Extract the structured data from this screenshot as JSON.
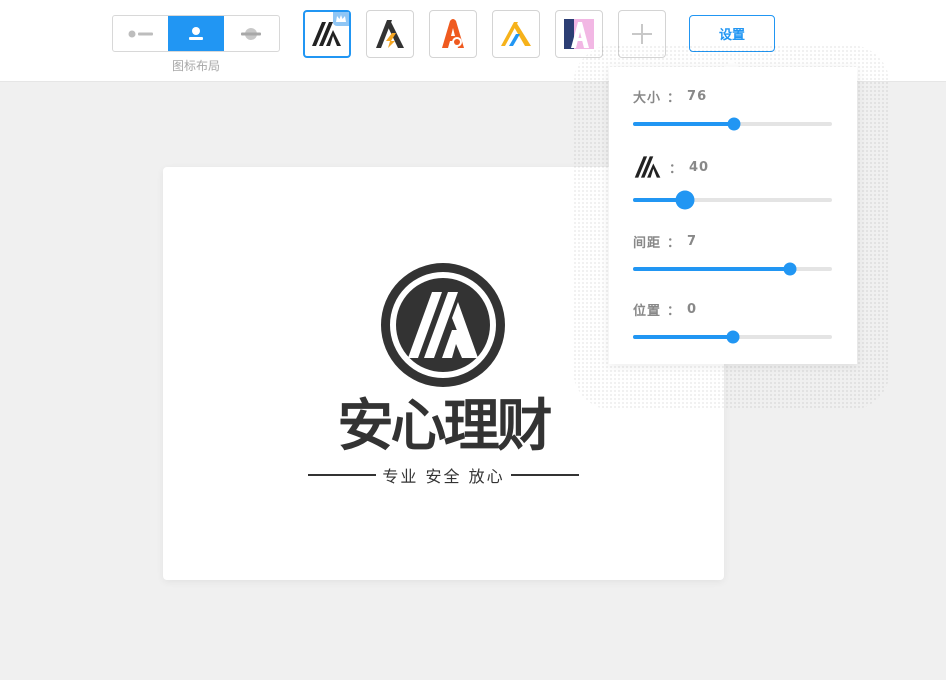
{
  "toolbar": {
    "layout_caption": "图标布局",
    "layout_options": [
      "icon-left",
      "icon-top",
      "icon-behind"
    ],
    "active_layout": "icon-top",
    "settings_label": "设置",
    "accent_color": "#2196f3"
  },
  "thumbnails": [
    {
      "icon": "slash-a-logo",
      "selected": true,
      "badge": "crown-icon"
    },
    {
      "icon": "lightning-a-logo",
      "selected": false
    },
    {
      "icon": "orange-a-logo",
      "selected": false
    },
    {
      "icon": "blue-yellow-a-logo",
      "selected": false
    },
    {
      "icon": "pink-blue-a-logo",
      "selected": false
    },
    {
      "icon": "plus-icon",
      "selected": false
    }
  ],
  "canvas": {
    "brand_name": "安心理财",
    "slogan": "专业 安全 放心",
    "emblem_icon": "slash-a-circle-logo"
  },
  "panel": {
    "size": {
      "label": "大小",
      "sep": "：",
      "value": "76",
      "fraction": 0.51
    },
    "icon_size": {
      "label_icon": "slash-a-logo",
      "sep": "：",
      "value": "40",
      "fraction": 0.26
    },
    "spacing": {
      "label": "间距",
      "sep": "：",
      "value": "7",
      "fraction": 0.79
    },
    "position": {
      "label": "位置",
      "sep": "：",
      "value": "0",
      "fraction": 0.5
    }
  }
}
